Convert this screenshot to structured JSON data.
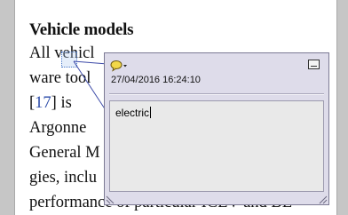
{
  "document": {
    "heading": "Vehicle models",
    "lines": [
      {
        "pre": "All vehicl",
        "ref": "",
        "post": ""
      },
      {
        "pre": "ware tool",
        "ref": "",
        "post": ""
      },
      {
        "pre": "[",
        "ref": "17",
        "post": "]  is"
      },
      {
        "pre": "Argonne",
        "ref": "",
        "post": ""
      },
      {
        "pre": "General M",
        "ref": "",
        "post": ""
      },
      {
        "pre": "gies, inclu",
        "ref": "",
        "post": ""
      },
      {
        "pre": "performance of particular ICEV and BE",
        "ref": "",
        "post": ""
      }
    ]
  },
  "note": {
    "icon": "speech-bubble-icon",
    "datetime": "27/04/2016 16:24:10",
    "text": "electric"
  },
  "colors": {
    "note_bg": "#dedcea",
    "note_body_bg": "#e9e9e9",
    "link": "#2a4aa8",
    "icon_yellow": "#f2d84a"
  }
}
